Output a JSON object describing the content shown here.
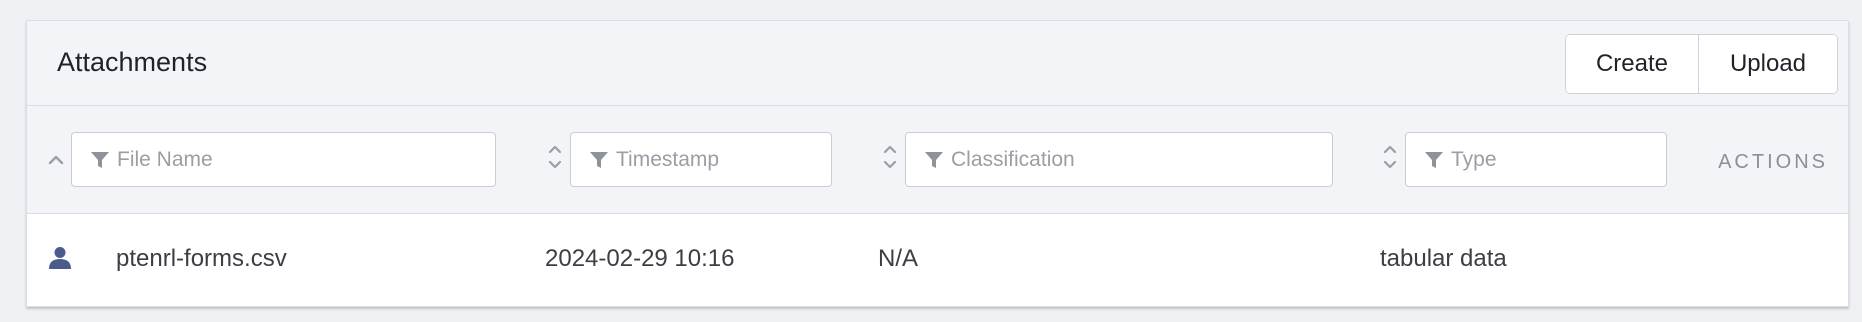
{
  "panel": {
    "title": "Attachments",
    "buttons": {
      "create_label": "Create",
      "upload_label": "Upload"
    }
  },
  "table": {
    "filters": {
      "file_name_placeholder": "File Name",
      "timestamp_placeholder": "Timestamp",
      "classification_placeholder": "Classification",
      "type_placeholder": "Type"
    },
    "actions_header": "ACTIONS",
    "sort": {
      "file_name": "ascending",
      "timestamp": "none",
      "classification": "none",
      "type": "none"
    },
    "rows": [
      {
        "owner_icon": "user-icon",
        "file_name": "ptenrl-forms.csv",
        "timestamp": "2024-02-29 10:16",
        "classification": "N/A",
        "type": "tabular data"
      }
    ]
  },
  "colors": {
    "header_bg": "#f3f4f7",
    "icon_blue": "#4a5b8c",
    "filter_icon": "#8e9299"
  }
}
